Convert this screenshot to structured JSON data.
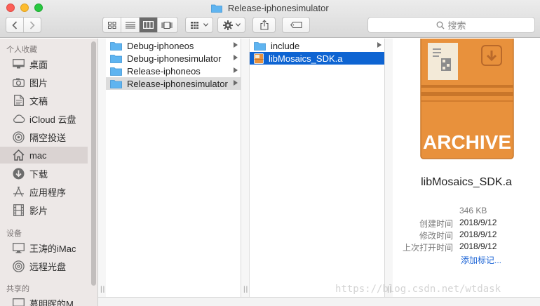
{
  "window": {
    "title": "Release-iphonesimulator"
  },
  "toolbar": {
    "search_placeholder": "搜索"
  },
  "sidebar": {
    "sections": [
      {
        "label": "个人收藏"
      },
      {
        "label": "设备"
      },
      {
        "label": "共享的"
      }
    ],
    "favorites": [
      {
        "label": "桌面",
        "icon": "desktop-icon"
      },
      {
        "label": "图片",
        "icon": "camera-icon"
      },
      {
        "label": "文稿",
        "icon": "document-icon"
      },
      {
        "label": "iCloud 云盘",
        "icon": "cloud-icon"
      },
      {
        "label": "隔空投送",
        "icon": "airdrop-icon"
      },
      {
        "label": "mac",
        "icon": "home-icon"
      },
      {
        "label": "下载",
        "icon": "download-icon"
      },
      {
        "label": "应用程序",
        "icon": "applications-icon"
      },
      {
        "label": "影片",
        "icon": "film-icon"
      }
    ],
    "devices": [
      {
        "label": "王涛的iMac",
        "icon": "imac-icon"
      },
      {
        "label": "远程光盘",
        "icon": "disc-icon"
      }
    ],
    "shared": [
      {
        "label": "慕明晖的M...",
        "icon": "computer-icon"
      }
    ]
  },
  "columns": {
    "col1": [
      {
        "label": "Debug-iphoneos"
      },
      {
        "label": "Debug-iphonesimulator"
      },
      {
        "label": "Release-iphoneos"
      },
      {
        "label": "Release-iphonesimulator"
      }
    ],
    "col2": [
      {
        "label": "include"
      },
      {
        "label": "libMosaics_SDK.a"
      }
    ]
  },
  "preview": {
    "icon_text": "ARCHIVE",
    "file_name": "libMosaics_SDK.a",
    "size": "346 KB",
    "created_label": "创建时间",
    "created_value": "2018/9/12",
    "modified_label": "修改时间",
    "modified_value": "2018/9/12",
    "opened_label": "上次打开时间",
    "opened_value": "2018/9/12",
    "add_tags": "添加标记..."
  },
  "watermark": "https://blog.csdn.net/wtdask",
  "colors": {
    "selection_blue": "#0e64d2",
    "folder_blue": "#5fb4f0",
    "archive_orange": "#e8913c",
    "link_blue": "#1a63d6"
  }
}
